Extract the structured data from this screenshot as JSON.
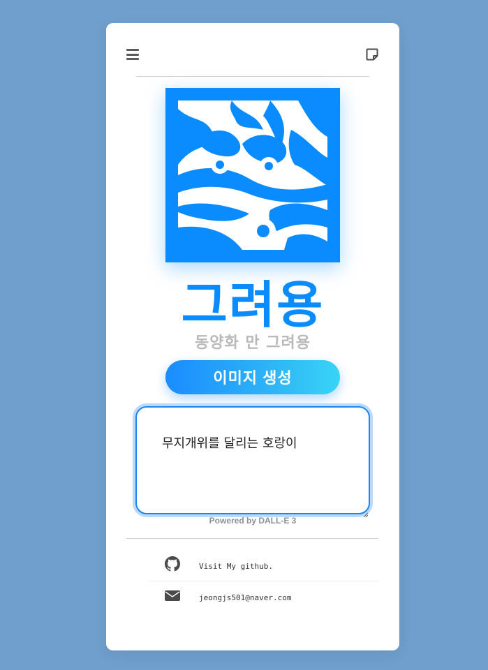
{
  "header": {
    "menu_icon": "hamburger-menu-icon",
    "note_icon": "sticky-note-icon"
  },
  "logo": {
    "icon": "dragon-oriental-art-logo",
    "background": "#0a8cff"
  },
  "app": {
    "title": "그려용",
    "subtitle": "동양화 만 그려용"
  },
  "generate_button": {
    "label": "이미지 생성"
  },
  "prompt": {
    "value": "무지개위를 달리는 호랑이"
  },
  "powered_by": "Powered by DALL-E 3",
  "links": [
    {
      "icon": "github-icon",
      "label": "Visit My github."
    },
    {
      "icon": "envelope-icon",
      "label": "jeongjs501@naver.com"
    }
  ],
  "colors": {
    "page_background": "#709fcd",
    "accent": "#0a8cff",
    "subtitle_gray": "#b9b9b9"
  }
}
